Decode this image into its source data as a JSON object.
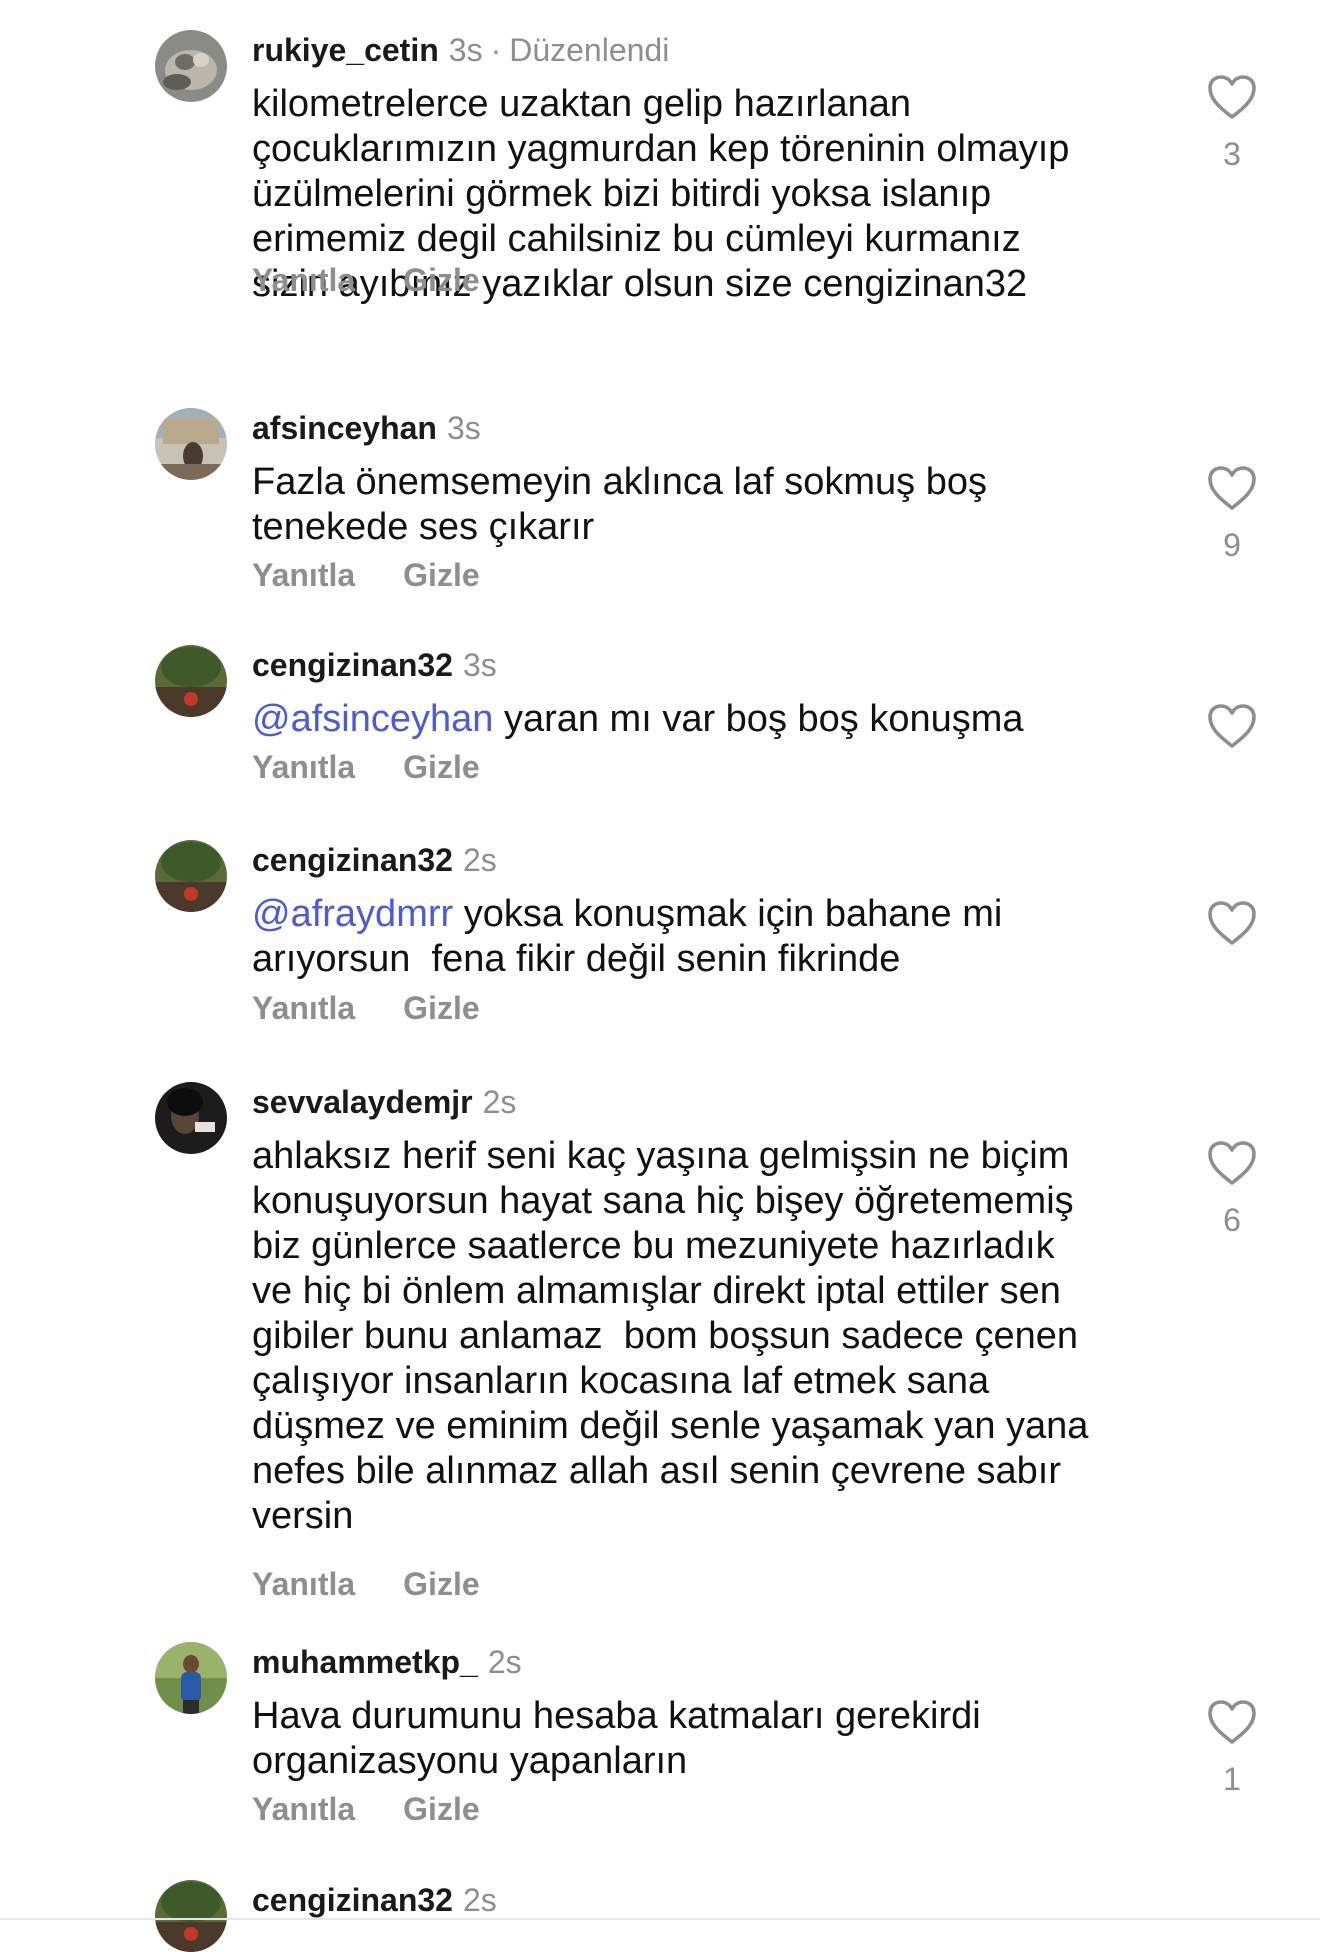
{
  "actions": {
    "reply_label": "Yanıtla",
    "hide_label": "Gizle"
  },
  "comments": [
    {
      "username": "rukiye_cetin",
      "time": "3s",
      "edited_label": "Düzenlendi",
      "lines": [
        "kilometrelerce uzaktan gelip hazırlanan",
        "çocuklarımızın yagmurdan kep töreninin olmayıp",
        "üzülmelerini görmek bizi bitirdi yoksa islanıp",
        "erimemiz degil cahilsiniz bu cümleyi kurmanız",
        "sizin ayıbınız yazıklar olsun size cengizinan32"
      ],
      "likes": "3"
    },
    {
      "username": "afsinceyhan",
      "time": "3s",
      "lines": [
        "Fazla önemsemeyin aklınca laf sokmuş boş",
        "tenekede ses çıkarır"
      ],
      "likes": "9"
    },
    {
      "username": "cengizinan32",
      "time": "3s",
      "mention": "@afsinceyhan",
      "lines": [
        " yaran mı var boş boş konuşma"
      ]
    },
    {
      "username": "cengizinan32",
      "time": "2s",
      "mention": "@afraydmrr",
      "lines": [
        " yoksa konuşmak için bahane mi",
        "arıyorsun  fena fikir değil senin fikrinde"
      ]
    },
    {
      "username": "sevvalaydemjr",
      "time": "2s",
      "lines": [
        "ahlaksız herif seni kaç yaşına gelmişsin ne biçim",
        "konuşuyorsun hayat sana hiç bişey öğretememiş",
        "biz günlerce saatlerce bu mezuniyete hazırladık",
        "ve hiç bi önlem almamışlar direkt iptal ettiler sen",
        "gibiler bunu anlamaz  bom boşsun sadece çenen",
        "çalışıyor insanların kocasına laf etmek sana",
        "düşmez ve eminim değil senle yaşamak yan yana",
        "nefes bile alınmaz allah asıl senin çevrene sabır",
        "versin"
      ],
      "likes": "6"
    },
    {
      "username": "muhammetkp_",
      "time": "2s",
      "lines": [
        "Hava durumunu hesaba katmaları gerekirdi",
        "organizasyonu yapanların"
      ],
      "likes": "1"
    },
    {
      "username": "cengizinan32",
      "time": "2s"
    }
  ],
  "colors": {
    "mention": "#4c5bd4",
    "secondary_text": "#8e8e8e",
    "primary_text": "#111111"
  },
  "icons": {
    "like": "heart-outline-icon"
  }
}
